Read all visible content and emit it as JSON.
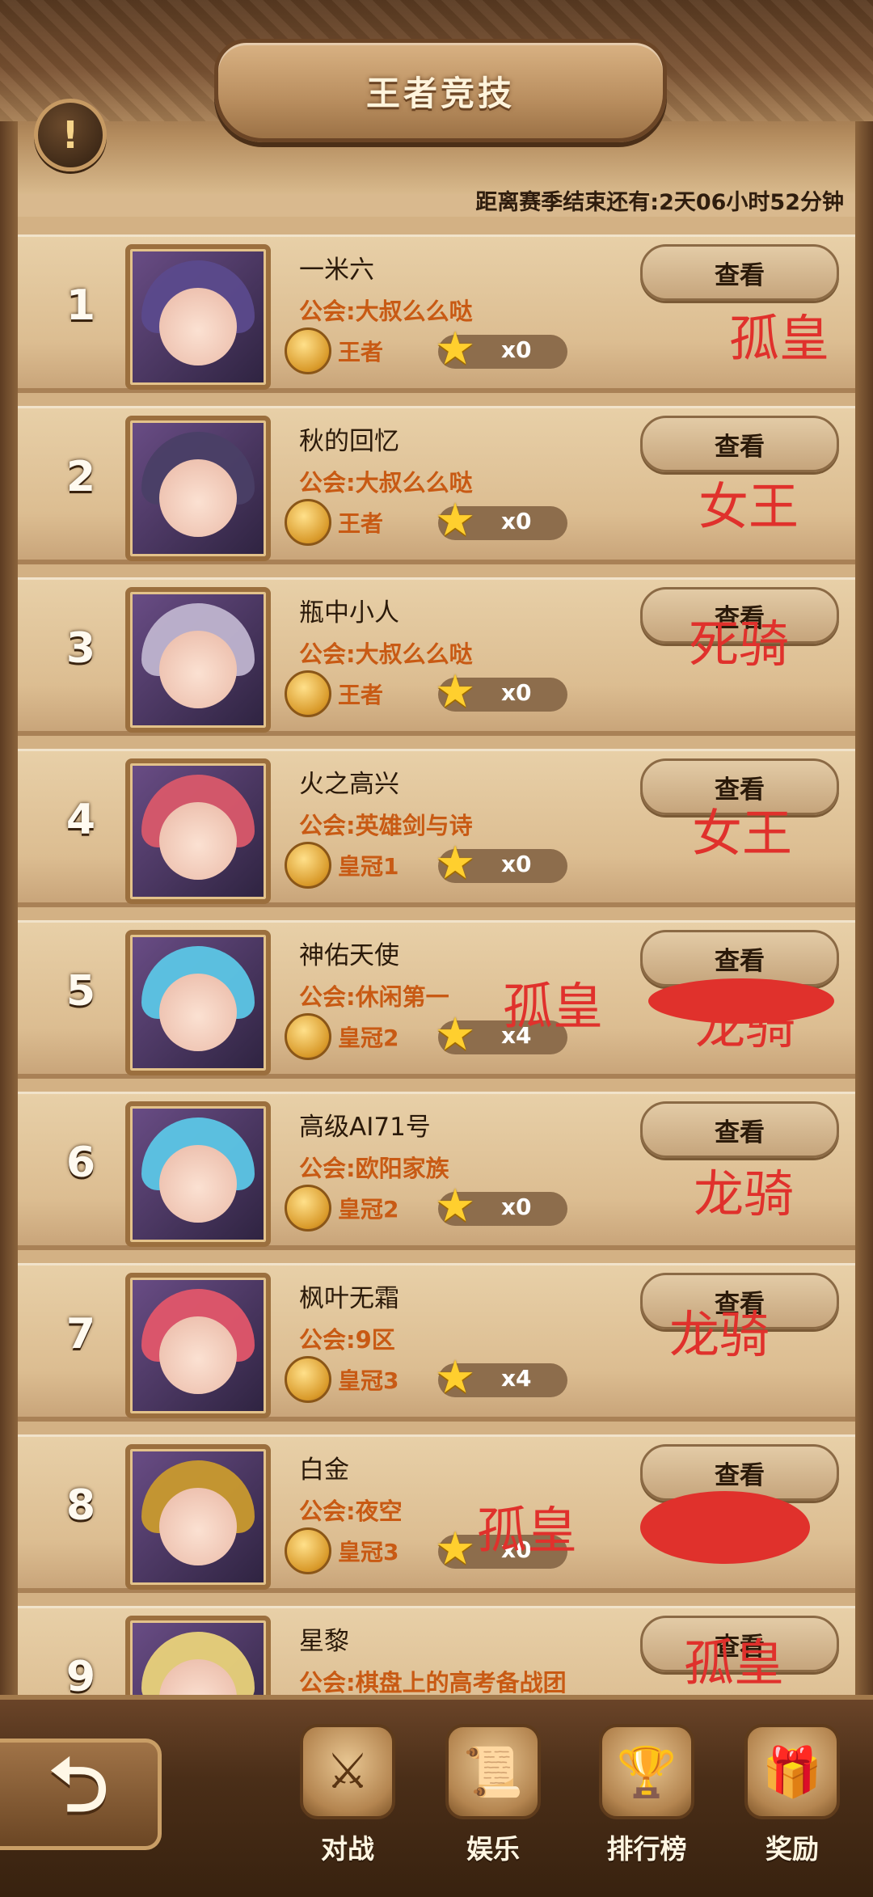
{
  "header": {
    "title": "王者竞技",
    "info_symbol": "!",
    "countdown_label": "距离赛季结束还有:",
    "countdown_value": "2天06小时52分钟"
  },
  "view_label": "查看",
  "guild_prefix": "公会:",
  "rows": [
    {
      "rank": "1",
      "name": "一米六",
      "guild": "大叔么么哒",
      "tier": "王者",
      "stars": "x0",
      "note": "孤皇",
      "colors": {
        "hair": "#5b4a8c"
      }
    },
    {
      "rank": "2",
      "name": "秋的回忆",
      "guild": "大叔么么哒",
      "tier": "王者",
      "stars": "x0",
      "note": "女王",
      "colors": {
        "hair": "#4a3f66"
      }
    },
    {
      "rank": "3",
      "name": "瓶中小人",
      "guild": "大叔么么哒",
      "tier": "王者",
      "stars": "x0",
      "note": "死骑",
      "colors": {
        "hair": "#bfb4cf"
      }
    },
    {
      "rank": "4",
      "name": "火之高兴",
      "guild": "英雄剑与诗",
      "tier": "皇冠1",
      "stars": "x0",
      "note": "女王",
      "colors": {
        "hair": "#d9586a"
      }
    },
    {
      "rank": "5",
      "name": "神佑天使",
      "guild": "休闲第一",
      "tier": "皇冠2",
      "stars": "x4",
      "note": "孤皇",
      "note2": "龙骑",
      "colors": {
        "hair": "#5cc6e6"
      }
    },
    {
      "rank": "6",
      "name": "高级AI71号",
      "guild": "欧阳家族",
      "tier": "皇冠2",
      "stars": "x0",
      "note": "龙骑",
      "colors": {
        "hair": "#5cc6e6"
      }
    },
    {
      "rank": "7",
      "name": "枫叶无霜",
      "guild": "9区",
      "tier": "皇冠3",
      "stars": "x4",
      "note": "龙骑",
      "colors": {
        "hair": "#e2566a"
      }
    },
    {
      "rank": "8",
      "name": "白金",
      "guild": "夜空",
      "tier": "皇冠3",
      "stars": "x0",
      "note": "孤皇",
      "colors": {
        "hair": "#c99a2e"
      }
    },
    {
      "rank": "9",
      "name": "星黎",
      "guild": "棋盘上的高考备战团",
      "tier": "",
      "stars": "",
      "note": "孤皇",
      "colors": {
        "hair": "#e9d27a"
      }
    }
  ],
  "bottom_nav": {
    "back_icon": "back-arrow-icon",
    "items": [
      {
        "label": "对战",
        "icon": "battle-icon"
      },
      {
        "label": "娱乐",
        "icon": "scroll-icon"
      },
      {
        "label": "排行榜",
        "icon": "trophy-icon"
      },
      {
        "label": "奖励",
        "icon": "chest-icon"
      }
    ]
  },
  "theme": {
    "accent": "#c85a14",
    "annotation": "#e0312c",
    "star": "#ffcf2e"
  }
}
